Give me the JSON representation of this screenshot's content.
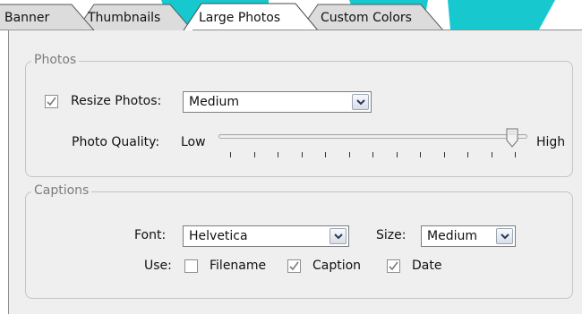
{
  "tabs": [
    {
      "label": "Banner"
    },
    {
      "label": "Thumbnails"
    },
    {
      "label": "Large Photos"
    },
    {
      "label": "Custom Colors"
    }
  ],
  "active_tab": "Large Photos",
  "photos": {
    "legend": "Photos",
    "resize_label": "Resize Photos:",
    "resize_checked": true,
    "resize_value": "Medium",
    "quality_label": "Photo Quality:",
    "quality_low": "Low",
    "quality_high": "High",
    "quality_fraction": 0.97,
    "quality_ticks": 13
  },
  "captions": {
    "legend": "Captions",
    "font_label": "Font:",
    "font_value": "Helvetica",
    "size_label": "Size:",
    "size_value": "Medium",
    "use_label": "Use:",
    "options": [
      {
        "label": "Filename",
        "checked": false
      },
      {
        "label": "Caption",
        "checked": true
      },
      {
        "label": "Date",
        "checked": true
      }
    ]
  },
  "colors": {
    "panel_bg": "#efefef",
    "accent": "#18c8cf",
    "active_tab_bg": "#ffffff",
    "inactive_tab_bg": "#dcdcdc",
    "check_mark": "#7c7c7c"
  }
}
